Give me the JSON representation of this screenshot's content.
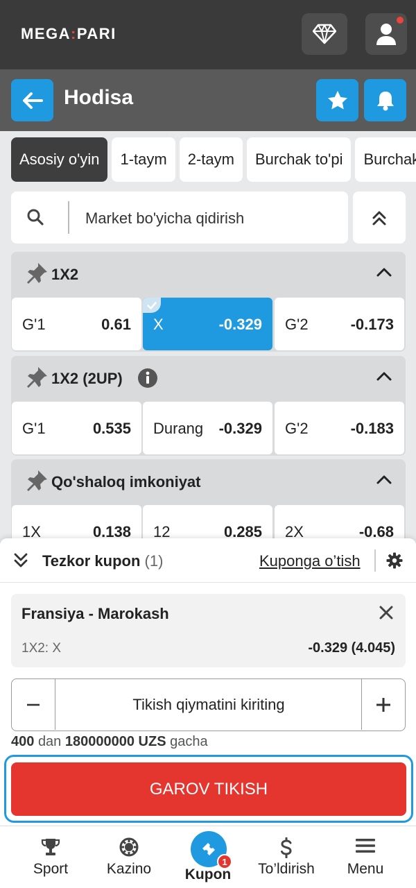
{
  "brand": {
    "logo_left": "MEGA",
    "logo_right": "PARI",
    "accent": "#1f9ae0",
    "danger": "#e5352f"
  },
  "topbar": {
    "diamond_icon": "diamond-icon",
    "user_icon": "user-icon",
    "notification": true
  },
  "header": {
    "title": "Hodisa"
  },
  "tabs": [
    "Asosiy o'yin",
    "1-taym",
    "2-taym",
    "Burchak to'pi",
    "Burchak"
  ],
  "search": {
    "placeholder": "Market bo'yicha qidirish"
  },
  "markets": [
    {
      "title": "1X2",
      "odds": [
        {
          "label": "G'1",
          "value": "0.61",
          "selected": false
        },
        {
          "label": "X",
          "value": "-0.329",
          "selected": true
        },
        {
          "label": "G'2",
          "value": "-0.173",
          "selected": false
        }
      ]
    },
    {
      "title": "1X2 (2UP)",
      "odds": [
        {
          "label": "G'1",
          "value": "0.535"
        },
        {
          "label": "Durang",
          "value": "-0.329"
        },
        {
          "label": "G'2",
          "value": "-0.183"
        }
      ]
    },
    {
      "title": "Qo'shaloq imkoniyat",
      "odds": [
        {
          "label": "1X",
          "value": "0.138"
        },
        {
          "label": "12",
          "value": "0.285"
        },
        {
          "label": "2X",
          "value": "-0.68"
        }
      ]
    }
  ],
  "coupon": {
    "title": "Tezkor kupon",
    "count": "(1)",
    "link": "Kuponga o’tish",
    "bet": {
      "match": "Fransiya - Marokash",
      "market": "1X2: X",
      "odds": "-0.329 (4.045)"
    },
    "stake_placeholder": "Tikish qiymatini kiriting",
    "limits": {
      "min": "400",
      "dan": "dan",
      "max": "180000000 UZS",
      "gacha": "gacha"
    },
    "place_label": "GAROV TIKISH"
  },
  "nav": {
    "sport": "Sport",
    "kazino": "Kazino",
    "kupon": "Kupon",
    "kupon_badge": "1",
    "toldirish": "To’ldirish",
    "menu": "Menu"
  }
}
